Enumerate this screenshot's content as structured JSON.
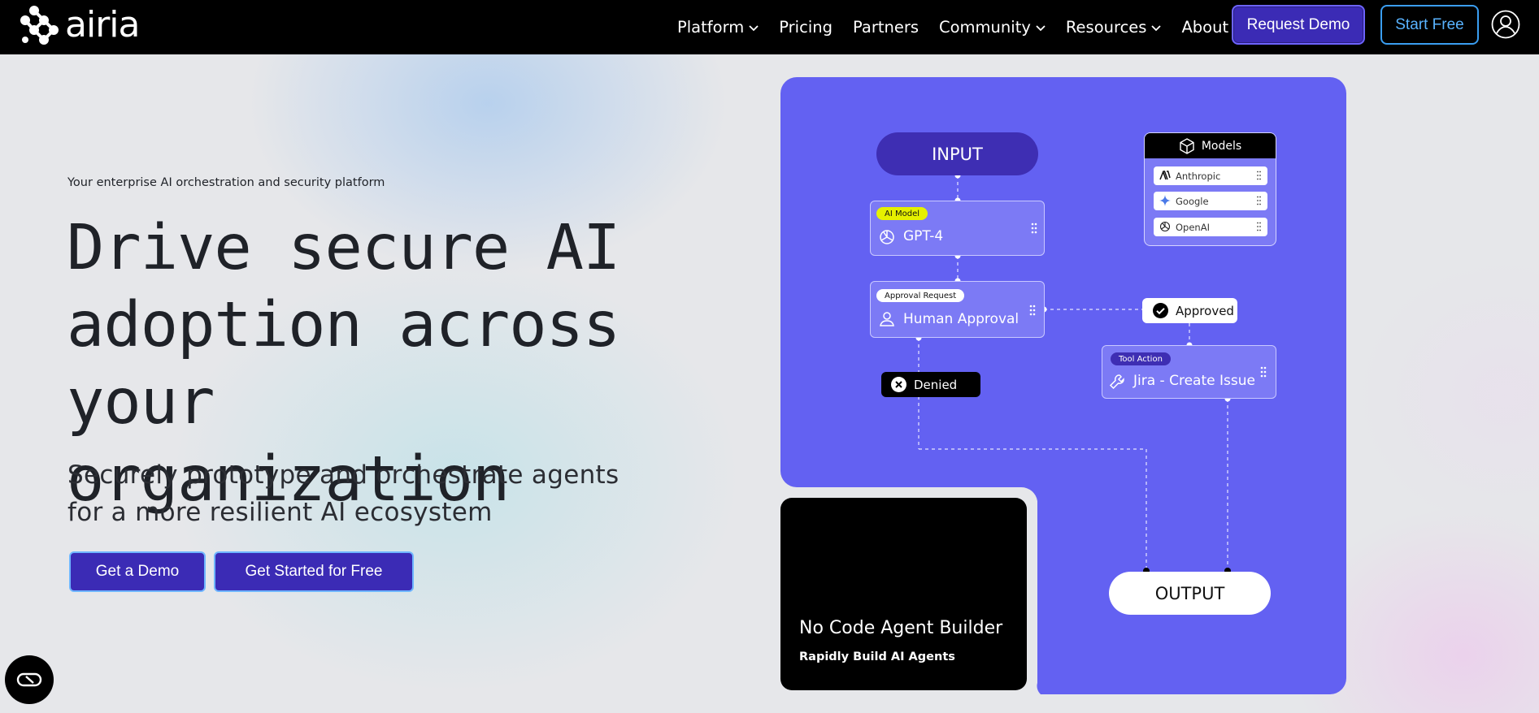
{
  "nav": {
    "logo_text": "airia",
    "links": [
      {
        "label": "Platform",
        "dropdown": true
      },
      {
        "label": "Pricing",
        "dropdown": false
      },
      {
        "label": "Partners",
        "dropdown": false
      },
      {
        "label": "Community",
        "dropdown": true
      },
      {
        "label": "Resources",
        "dropdown": true
      },
      {
        "label": "About",
        "dropdown": false
      }
    ],
    "request_demo": "Request Demo",
    "start_free": "Start Free"
  },
  "hero": {
    "tagline": "Your enterprise AI orchestration and security platform",
    "headline_lines": [
      "Drive secure AI",
      "adoption across",
      "your organization"
    ],
    "subline_lines": [
      "Securely prototype and orchestrate agents",
      "for a more resilient AI ecosystem"
    ],
    "cta_demo": "Get a Demo",
    "cta_free": "Get Started for Free"
  },
  "graphic": {
    "input_label": "INPUT",
    "output_label": "OUTPUT",
    "ai_model": {
      "tag": "AI Model",
      "title": "GPT-4"
    },
    "approval": {
      "tag": "Approval Request",
      "title": "Human Approval"
    },
    "tool": {
      "tag": "Tool Action",
      "title": "Jira - Create Issue"
    },
    "approved_label": "Approved",
    "denied_label": "Denied",
    "models": {
      "title": "Models",
      "items": [
        "Anthropic",
        "Google",
        "OpenAI"
      ]
    },
    "video": {
      "title": "No Code Agent Builder",
      "subtitle": "Rapidly Build AI Agents"
    }
  },
  "colors": {
    "panel_purple": "#6361f2",
    "button_purple": "#3b2bb5",
    "accent_blue": "#59b3ff",
    "ai_tag_yellow": "#e5f000"
  }
}
